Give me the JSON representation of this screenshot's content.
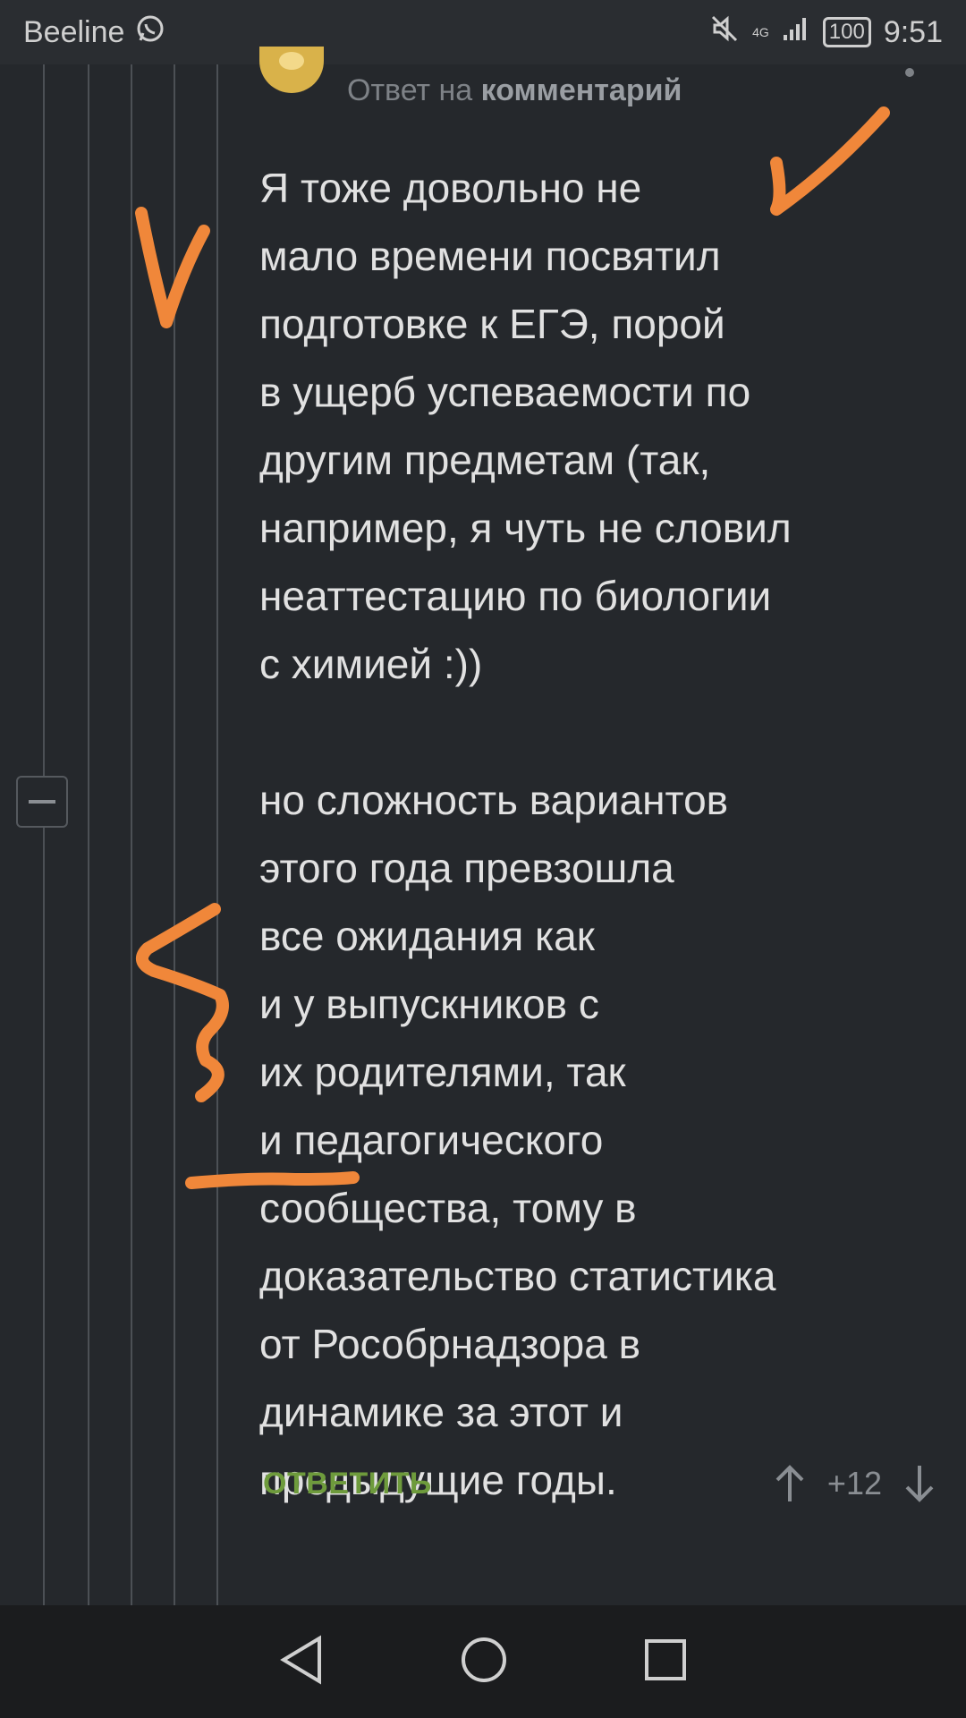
{
  "status_bar": {
    "carrier": "Beeline",
    "network_type": "4G",
    "battery": "100",
    "time": "9:51"
  },
  "comment": {
    "reply_prefix": "Ответ на",
    "reply_target": "комментарий",
    "paragraph_1": "Я тоже довольно не\nмало времени посвятил\nподготовке к ЕГЭ, порой\nв ущерб успеваемости по\nдругим предметам (так,\nнапример, я чуть не словил\nнеаттестацию по биологии\nс химией :))",
    "paragraph_2": "но сложность вариантов\nэтого года превзошла\nвсе ожидания как\nи у выпускников с\nих родителями, так\nи педагогического\nсообщества, тому в\nдоказательство статистика\nот Рособрнадзора в\nдинамике за этот и\nпредыдущие годы.",
    "reply_button": "ОТВЕТИТЬ",
    "rating": "+12"
  },
  "colors": {
    "background": "#25282c",
    "reply_green": "#6e9b3c",
    "annotation_orange": "#f0873a"
  },
  "icons": {
    "status": [
      "whatsapp-icon",
      "mute-icon",
      "signal-icon",
      "battery-icon"
    ],
    "nav": [
      "back-icon",
      "home-icon",
      "recents-icon"
    ],
    "comment": [
      "avatar",
      "collapse-icon",
      "upvote-icon",
      "downvote-icon",
      "more-icon"
    ]
  }
}
